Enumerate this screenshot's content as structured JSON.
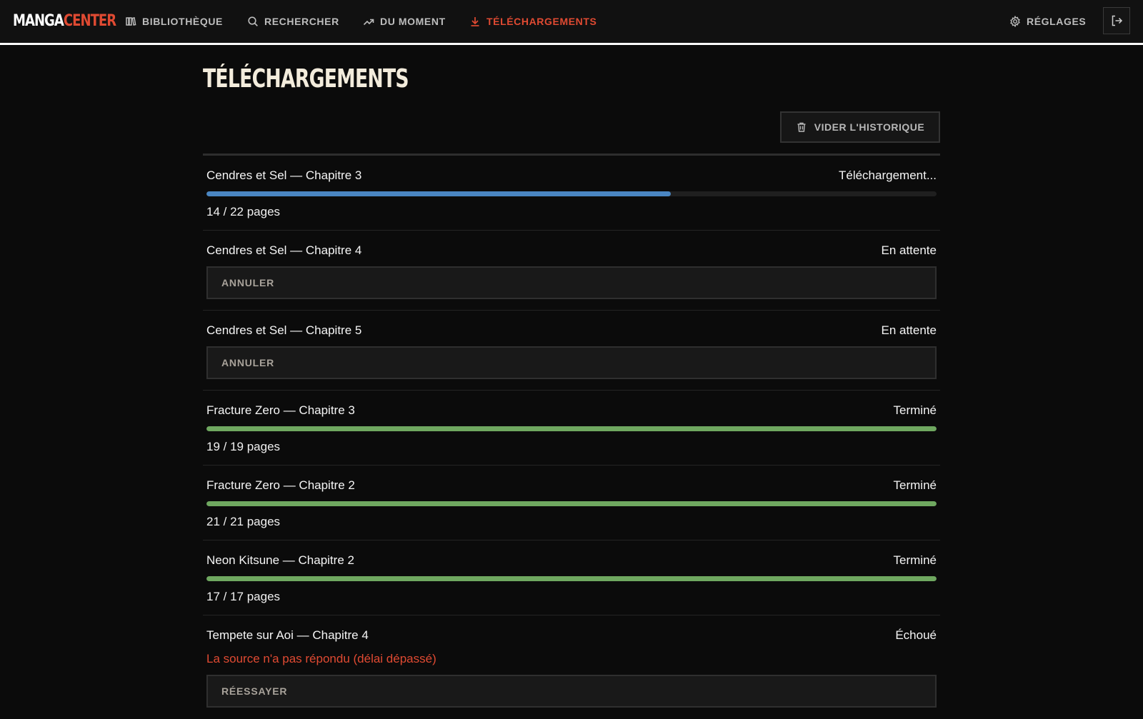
{
  "app": {
    "logo_part1": "MANGA",
    "logo_part2": "CENTER",
    "accent_color": "#e04a32",
    "progress_color": "#4a86c2",
    "done_color": "#6fa860"
  },
  "nav": {
    "items": [
      {
        "label": "BIBLIOTHÈQUE",
        "icon": "library-icon"
      },
      {
        "label": "RECHERCHER",
        "icon": "search-icon"
      },
      {
        "label": "DU MOMENT",
        "icon": "trending-icon"
      },
      {
        "label": "TÉLÉCHARGEMENTS",
        "icon": "download-icon",
        "active": true
      }
    ],
    "settings_label": "RÉGLAGES",
    "settings_icon": "gear-icon",
    "logout_icon": "logout-icon"
  },
  "page": {
    "title": "TÉLÉCHARGEMENTS",
    "clear_history_label": "VIDER L'HISTORIQUE",
    "clear_history_icon": "trash-icon"
  },
  "downloads": [
    {
      "title": "Cendres et Sel — Chapitre 3",
      "status": "Téléchargement...",
      "progress": 0.636,
      "pages": "14 / 22 pages"
    },
    {
      "title": "Cendres et Sel — Chapitre 4",
      "status": "En attente",
      "action": "ANNULER"
    },
    {
      "title": "Cendres et Sel — Chapitre 5",
      "status": "En attente",
      "action": "ANNULER"
    },
    {
      "title": "Fracture Zero — Chapitre 3",
      "status": "Terminé",
      "progress": 1.0,
      "pages": "19 / 19 pages"
    },
    {
      "title": "Fracture Zero — Chapitre 2",
      "status": "Terminé",
      "progress": 1.0,
      "pages": "21 / 21 pages"
    },
    {
      "title": "Neon Kitsune — Chapitre 2",
      "status": "Terminé",
      "progress": 1.0,
      "pages": "17 / 17 pages"
    },
    {
      "title": "Tempete sur Aoi — Chapitre 4",
      "status": "Échoué",
      "error": "La source n'a pas répondu (délai dépassé)",
      "action": "RÉESSAYER"
    }
  ]
}
